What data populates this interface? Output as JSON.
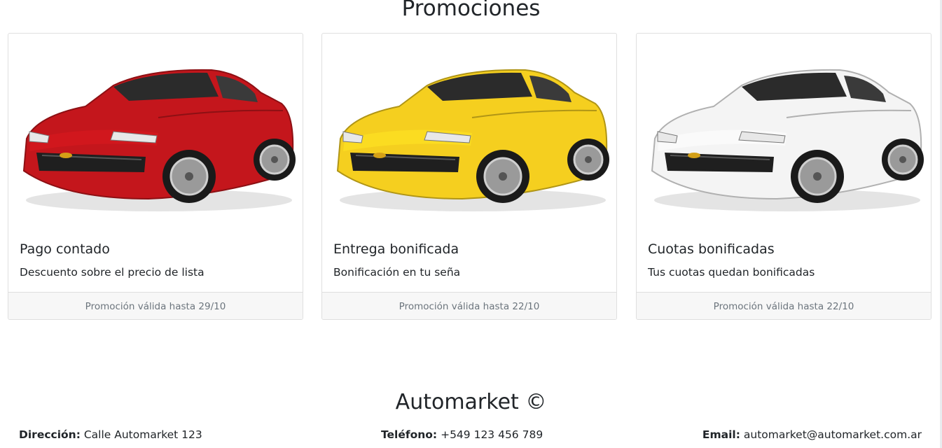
{
  "section": {
    "title": "Promociones"
  },
  "cards": [
    {
      "title": "Pago contado",
      "text": "Descuento sobre el precio de lista",
      "footer": "Promoción válida hasta 29/10",
      "car_color": "#c4161c",
      "image": "red-car-icon"
    },
    {
      "title": "Entrega bonificada",
      "text": "Bonificación en tu seña",
      "footer": "Promoción válida hasta 22/10",
      "car_color": "#f5cf1f",
      "image": "yellow-car-icon"
    },
    {
      "title": "Cuotas bonificadas",
      "text": "Tus cuotas quedan bonificadas",
      "footer": "Promoción válida hasta 22/10",
      "car_color": "#f4f4f4",
      "image": "white-car-icon"
    }
  ],
  "footer": {
    "brand": "Automarket ©",
    "address_label": "Dirección:",
    "address_value": "Calle Automarket 123",
    "phone_label": "Teléfono:",
    "phone_value": "+549 123 456 789",
    "email_label": "Email:",
    "email_value": "automarket@automarket.com.ar"
  }
}
